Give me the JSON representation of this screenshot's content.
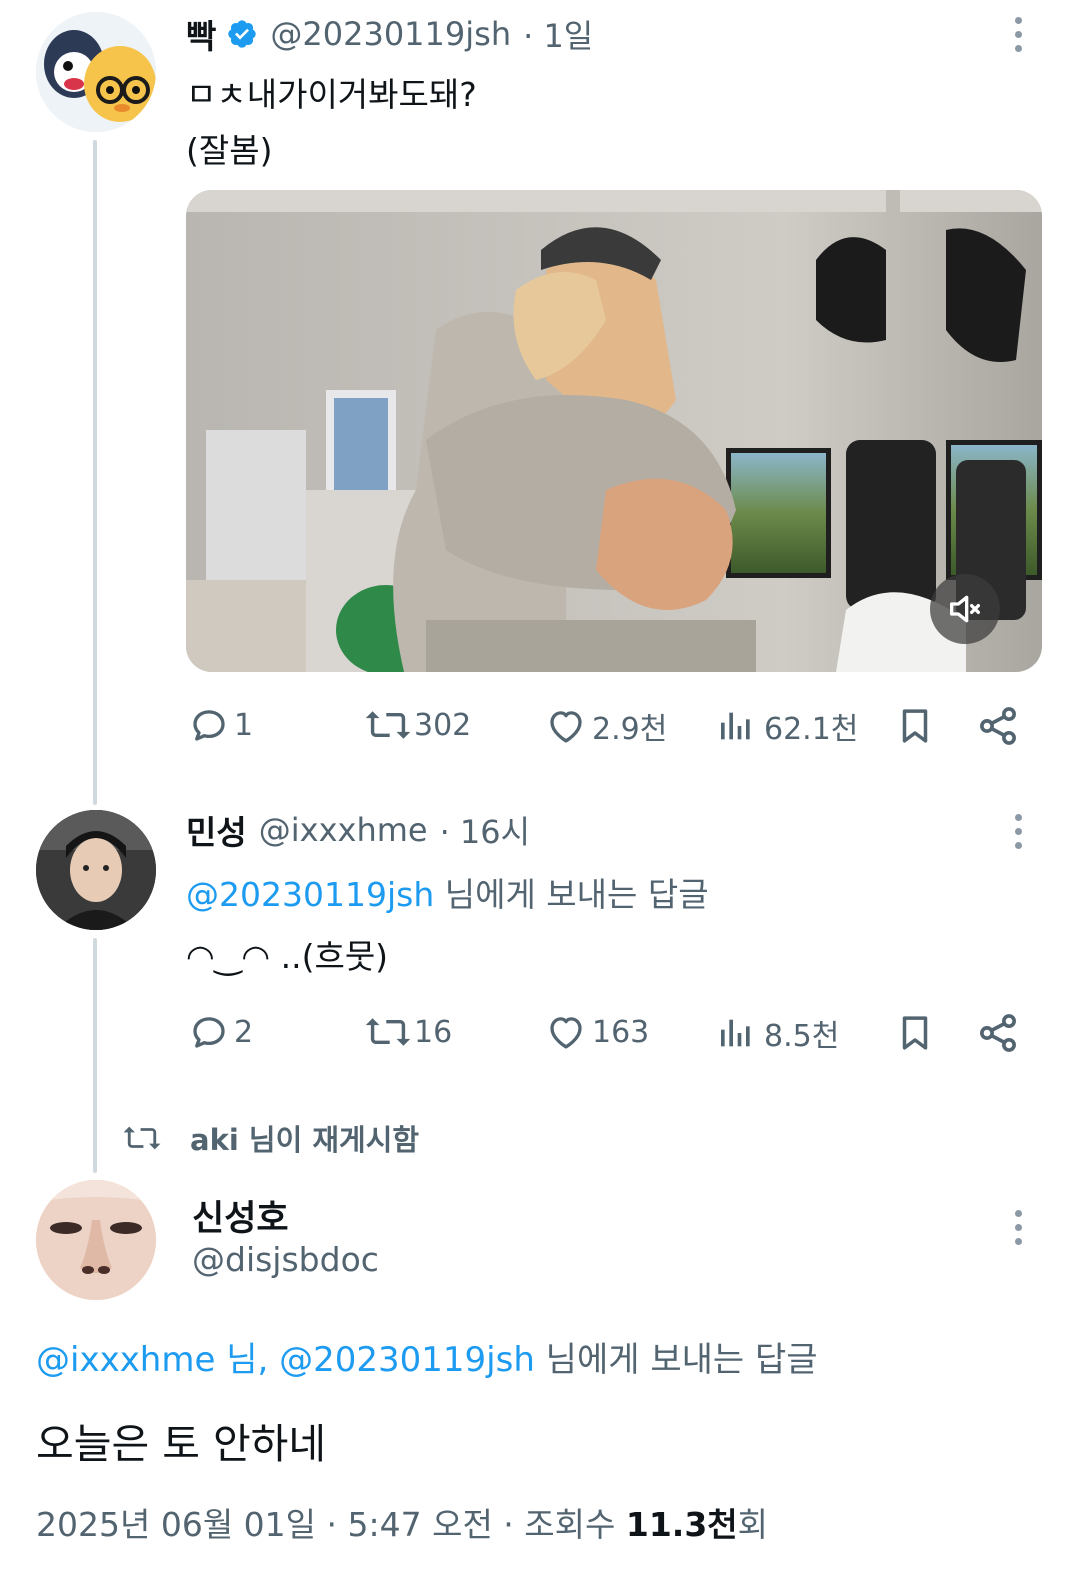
{
  "tweet1": {
    "name": "빡",
    "handle": "@20230119jsh",
    "time": "· 1일",
    "text_line1": "ㅁㅊ내가이거봐도돼?",
    "text_line2": "(잘봄)",
    "stats": {
      "replies": "1",
      "retweets": "302",
      "likes": "2.9천",
      "views": "62.1천"
    }
  },
  "tweet2": {
    "name": "민성",
    "handle": "@ixxxhme",
    "time": "· 16시",
    "reply_to_handle": "@20230119jsh",
    "reply_to_suffix": " 님에게 보내는 답글",
    "text": "◠‿◠ ..(흐뭇)",
    "stats": {
      "replies": "2",
      "retweets": "16",
      "likes": "163",
      "views": "8.5천"
    }
  },
  "repost_banner": {
    "text": "aki 님이 재게시함"
  },
  "tweet3": {
    "name": "신성호",
    "handle": "@disjsbdoc",
    "reply_to_handle1": "@ixxxhme 님,",
    "reply_to_handle2": "@20230119jsh",
    "reply_to_suffix": " 님에게 보내는 답글",
    "text": "오늘은 토 안하네",
    "meta_prefix": "2025년 06월 01일 · 5:47 오전 · 조회수 ",
    "meta_views": "11.3천",
    "meta_suffix": "회"
  },
  "colors": {
    "link": "#1d9bf0",
    "muted": "#536471",
    "verified": "#1d9bf0",
    "thread_line": "#cfd9de"
  },
  "icons": [
    "verified-badge-icon",
    "more-icon",
    "reply-icon",
    "retweet-icon",
    "like-icon",
    "views-icon",
    "bookmark-icon",
    "share-icon",
    "mute-icon"
  ]
}
